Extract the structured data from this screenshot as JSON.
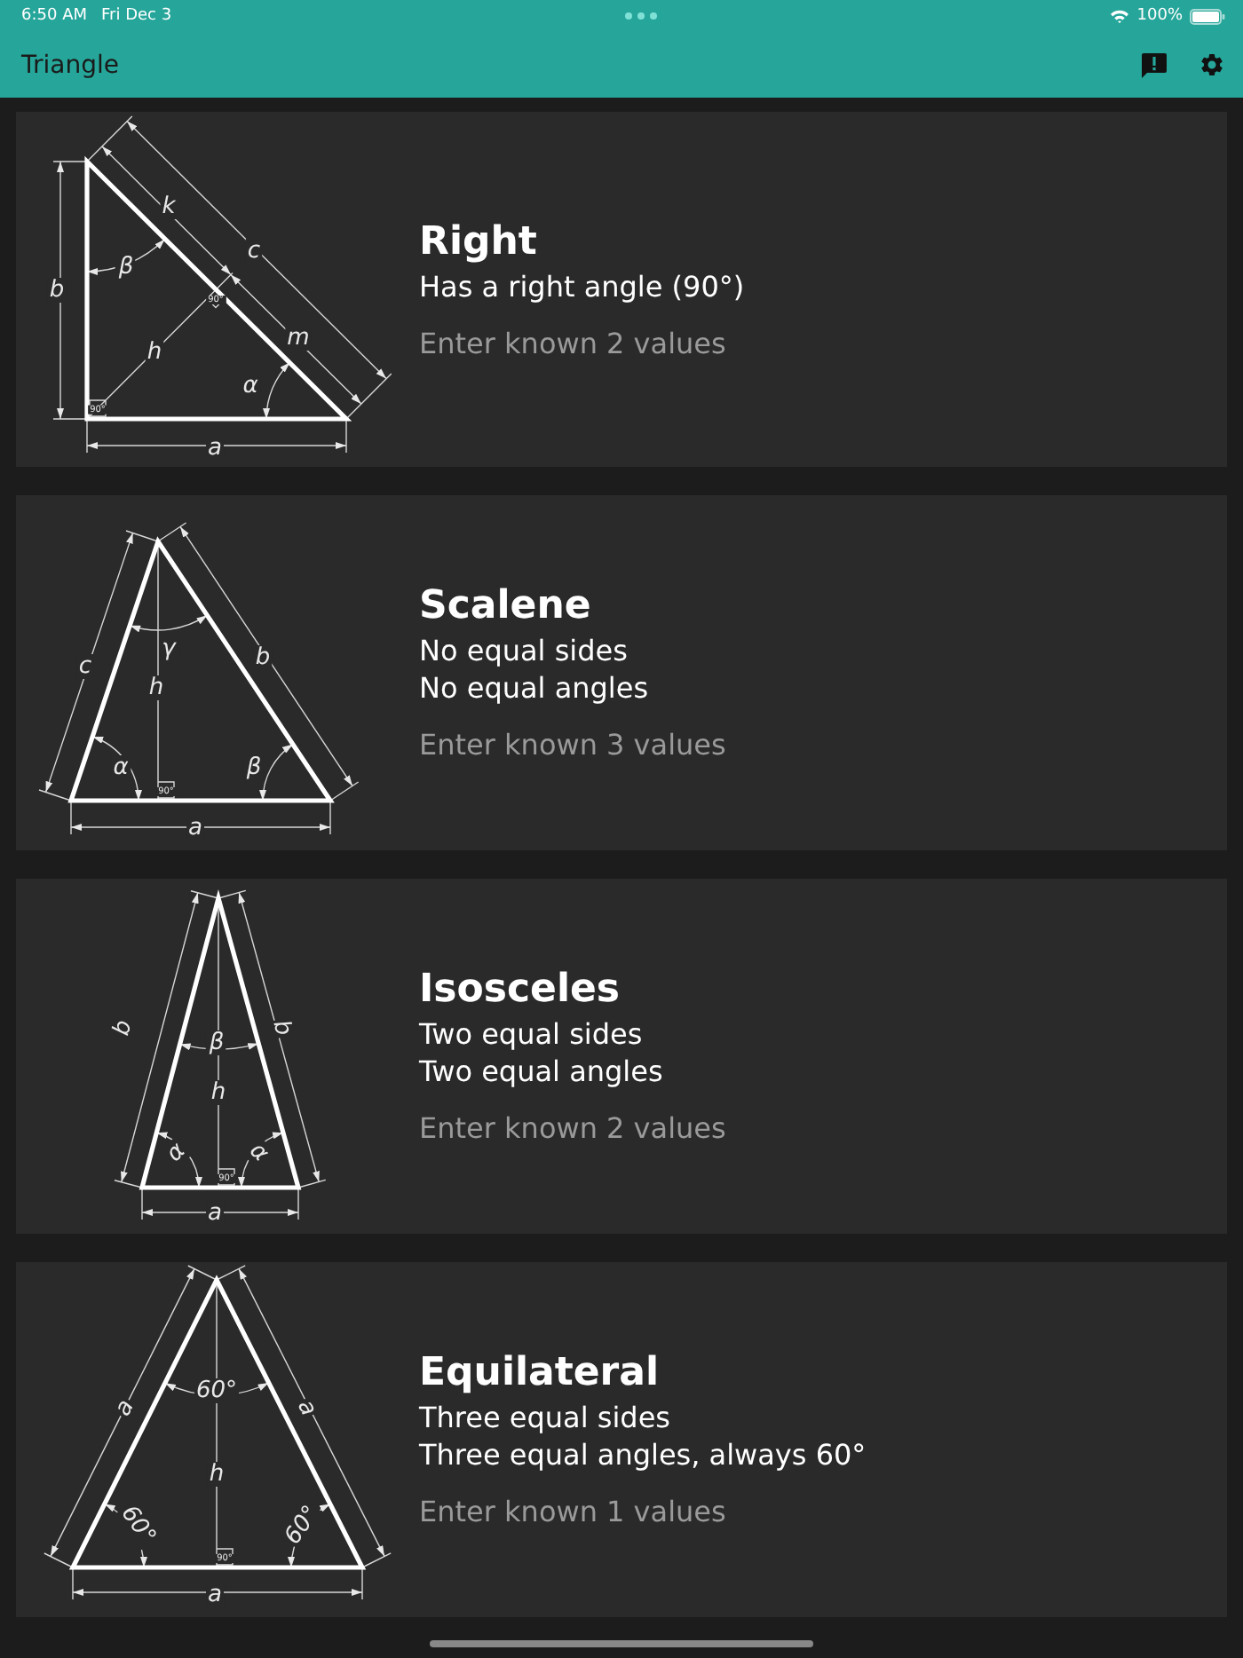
{
  "status_bar": {
    "time": "6:50 AM",
    "date": "Fri Dec 3",
    "battery": "100%"
  },
  "app_bar": {
    "title": "Triangle"
  },
  "cards": [
    {
      "title": "Right",
      "description": [
        "Has a right angle (90°)"
      ],
      "hint": "Enter known 2 values",
      "diagram": {
        "kind": "right",
        "labels": [
          "k",
          "c",
          "β",
          "b",
          "h",
          "m",
          "α",
          "a",
          "90°",
          "90°"
        ]
      }
    },
    {
      "title": "Scalene",
      "description": [
        "No equal sides",
        "No equal angles"
      ],
      "hint": "Enter known 3 values",
      "diagram": {
        "kind": "scalene",
        "labels": [
          "c",
          "γ",
          "b",
          "h",
          "α",
          "β",
          "a",
          "90°"
        ]
      }
    },
    {
      "title": "Isosceles",
      "description": [
        "Two equal sides",
        "Two equal angles"
      ],
      "hint": "Enter known 2 values",
      "diagram": {
        "kind": "isosceles",
        "labels": [
          "b",
          "b",
          "β",
          "h",
          "α",
          "α",
          "a",
          "90°"
        ]
      }
    },
    {
      "title": "Equilateral",
      "description": [
        "Three equal sides",
        "Three equal angles, always 60°"
      ],
      "hint": "Enter known 1 values",
      "diagram": {
        "kind": "equilateral",
        "labels": [
          "a",
          "a",
          "60°",
          "h",
          "60°",
          "60°",
          "a",
          "90°"
        ]
      }
    }
  ]
}
